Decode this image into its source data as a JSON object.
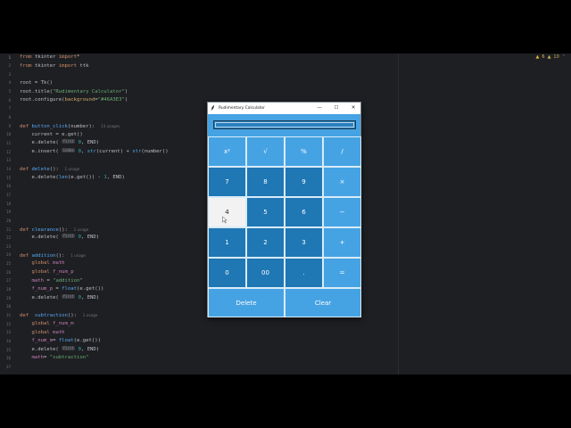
{
  "editor": {
    "gutter": {
      "line_numbers": [
        "1",
        "2",
        "3",
        "4",
        "5",
        "6",
        "7",
        "8",
        "9",
        "10",
        "11",
        "12",
        "13",
        "14",
        "15",
        "16",
        "17",
        "18",
        "19",
        "20",
        "21",
        "22",
        "23",
        "24",
        "25",
        "26",
        "27",
        "28",
        "29",
        "30",
        "31",
        "32",
        "33",
        "34",
        "35",
        "36",
        "37"
      ]
    },
    "inspections": {
      "warnings": "6",
      "weak_warnings": "10"
    },
    "lines": [
      [
        {
          "t": "from",
          "c": "kw"
        },
        {
          "t": " tkinter "
        },
        {
          "t": "import",
          "c": "kw"
        },
        {
          "t": "*"
        }
      ],
      [
        {
          "t": "from",
          "c": "kw"
        },
        {
          "t": " tkinter "
        },
        {
          "t": "import",
          "c": "kw"
        },
        {
          "t": " ttk"
        }
      ],
      [],
      [
        {
          "t": "root = Tk()"
        }
      ],
      [
        {
          "t": "root.title("
        },
        {
          "t": "\"Rudimentary Calculator\"",
          "c": "str"
        },
        {
          "t": ")"
        }
      ],
      [
        {
          "t": "root.configure("
        },
        {
          "t": "background",
          "c": "param"
        },
        {
          "t": "="
        },
        {
          "t": "\"#46A3E3\"",
          "c": "str"
        },
        {
          "t": ")"
        }
      ],
      [],
      [],
      [
        {
          "t": "def",
          "c": "kw"
        },
        {
          "t": " "
        },
        {
          "t": "button_click",
          "c": "fn"
        },
        {
          "t": "(number):  "
        },
        {
          "t": "13 usages",
          "c": "usage"
        }
      ],
      [
        {
          "t": "    current = e.get()"
        }
      ],
      [
        {
          "t": "    e.delete( "
        },
        {
          "t": "first",
          "c": "hint"
        },
        {
          "t": " "
        },
        {
          "t": "0",
          "c": "num"
        },
        {
          "t": ", END)"
        }
      ],
      [
        {
          "t": "    e.insert( "
        },
        {
          "t": "index",
          "c": "hint"
        },
        {
          "t": " "
        },
        {
          "t": "0",
          "c": "num"
        },
        {
          "t": ", "
        },
        {
          "t": "str",
          "c": "fn"
        },
        {
          "t": "(current) + "
        },
        {
          "t": "str",
          "c": "fn"
        },
        {
          "t": "(number))"
        }
      ],
      [],
      [
        {
          "t": "def",
          "c": "kw"
        },
        {
          "t": " "
        },
        {
          "t": "delete",
          "c": "fn"
        },
        {
          "t": "():  "
        },
        {
          "t": "1 usage",
          "c": "usage"
        }
      ],
      [
        {
          "t": "    e.delete("
        },
        {
          "t": "len",
          "c": "fn"
        },
        {
          "t": "(e.get()) - "
        },
        {
          "t": "1",
          "c": "num"
        },
        {
          "t": ", END)"
        }
      ],
      [],
      [],
      [],
      [],
      [],
      [
        {
          "t": "def",
          "c": "kw"
        },
        {
          "t": " "
        },
        {
          "t": "clearance",
          "c": "fn"
        },
        {
          "t": "():  "
        },
        {
          "t": "1 usage",
          "c": "usage"
        }
      ],
      [
        {
          "t": "    e.delete( "
        },
        {
          "t": "first",
          "c": "hint"
        },
        {
          "t": " "
        },
        {
          "t": "0",
          "c": "num"
        },
        {
          "t": ", END)"
        }
      ],
      [],
      [
        {
          "t": "def",
          "c": "kw"
        },
        {
          "t": " "
        },
        {
          "t": "addition",
          "c": "fn"
        },
        {
          "t": "():  "
        },
        {
          "t": "1 usage",
          "c": "usage"
        }
      ],
      [
        {
          "t": "    "
        },
        {
          "t": "global",
          "c": "kw"
        },
        {
          "t": " "
        },
        {
          "t": "math",
          "c": "glob"
        }
      ],
      [
        {
          "t": "    "
        },
        {
          "t": "global",
          "c": "kw"
        },
        {
          "t": " "
        },
        {
          "t": "f_num_p",
          "c": "glob"
        }
      ],
      [
        {
          "t": "    "
        },
        {
          "t": "math",
          "c": "glob"
        },
        {
          "t": " = "
        },
        {
          "t": "\"addition\"",
          "c": "str"
        }
      ],
      [
        {
          "t": "    "
        },
        {
          "t": "f_num_p",
          "c": "glob"
        },
        {
          "t": " = "
        },
        {
          "t": "float",
          "c": "fn"
        },
        {
          "t": "(e.get())"
        }
      ],
      [
        {
          "t": "    e.delete( "
        },
        {
          "t": "first",
          "c": "hint"
        },
        {
          "t": " "
        },
        {
          "t": "0",
          "c": "num"
        },
        {
          "t": ", END)"
        }
      ],
      [],
      [
        {
          "t": "def",
          "c": "kw"
        },
        {
          "t": "  "
        },
        {
          "t": "subtraction",
          "c": "fn"
        },
        {
          "t": "():  "
        },
        {
          "t": "1 usage",
          "c": "usage"
        }
      ],
      [
        {
          "t": "    "
        },
        {
          "t": "global",
          "c": "kw"
        },
        {
          "t": " "
        },
        {
          "t": "f_num_m",
          "c": "glob"
        }
      ],
      [
        {
          "t": "    "
        },
        {
          "t": "global",
          "c": "kw"
        },
        {
          "t": " "
        },
        {
          "t": "math",
          "c": "glob"
        }
      ],
      [
        {
          "t": "    "
        },
        {
          "t": "f_num_m",
          "c": "glob"
        },
        {
          "t": "= "
        },
        {
          "t": "float",
          "c": "fn"
        },
        {
          "t": "(e.get())"
        }
      ],
      [
        {
          "t": "    e.delete( "
        },
        {
          "t": "first",
          "c": "hint"
        },
        {
          "t": " "
        },
        {
          "t": "0",
          "c": "num"
        },
        {
          "t": ", END)"
        }
      ],
      [
        {
          "t": "    "
        },
        {
          "t": "math",
          "c": "glob"
        },
        {
          "t": "= "
        },
        {
          "t": "\"subtraction\"",
          "c": "str"
        }
      ],
      []
    ]
  },
  "calculator": {
    "title": "Rudimentary Calculator",
    "background": "#46A3E3",
    "display_value": "",
    "controls": {
      "minimize": "—",
      "maximize": "☐",
      "close": "✕"
    },
    "buttons": [
      {
        "label": "x²",
        "name": "square-button",
        "style": "light"
      },
      {
        "label": "√",
        "name": "sqrt-button",
        "style": "light"
      },
      {
        "label": "%",
        "name": "percent-button",
        "style": "light"
      },
      {
        "label": "/",
        "name": "divide-button",
        "style": "light"
      },
      {
        "label": "7",
        "name": "digit-7-button",
        "style": "dark"
      },
      {
        "label": "8",
        "name": "digit-8-button",
        "style": "dark"
      },
      {
        "label": "9",
        "name": "digit-9-button",
        "style": "dark"
      },
      {
        "label": "×",
        "name": "multiply-button",
        "style": "light"
      },
      {
        "label": "4",
        "name": "digit-4-button",
        "style": "white"
      },
      {
        "label": "5",
        "name": "digit-5-button",
        "style": "dark"
      },
      {
        "label": "6",
        "name": "digit-6-button",
        "style": "dark"
      },
      {
        "label": "−",
        "name": "subtract-button",
        "style": "light"
      },
      {
        "label": "1",
        "name": "digit-1-button",
        "style": "dark"
      },
      {
        "label": "2",
        "name": "digit-2-button",
        "style": "dark"
      },
      {
        "label": "3",
        "name": "digit-3-button",
        "style": "dark"
      },
      {
        "label": "+",
        "name": "add-button",
        "style": "light"
      },
      {
        "label": "0",
        "name": "digit-0-button",
        "style": "dark"
      },
      {
        "label": "00",
        "name": "double-zero-button",
        "style": "dark"
      },
      {
        "label": ".",
        "name": "decimal-button",
        "style": "dark"
      },
      {
        "label": "=",
        "name": "equals-button",
        "style": "light"
      },
      {
        "label": "Delete",
        "name": "delete-button",
        "style": "light"
      },
      {
        "label": "Clear",
        "name": "clear-button",
        "style": "light"
      }
    ]
  }
}
